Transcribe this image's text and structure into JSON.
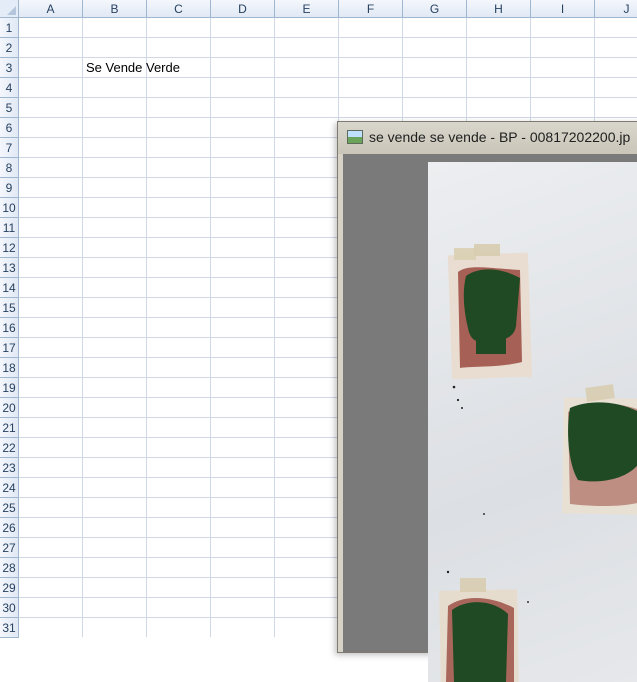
{
  "spreadsheet": {
    "columns": [
      "A",
      "B",
      "C",
      "D",
      "E",
      "F",
      "G",
      "H",
      "I",
      "J"
    ],
    "rows": [
      "1",
      "2",
      "3",
      "4",
      "5",
      "6",
      "7",
      "8",
      "9",
      "10",
      "11",
      "12",
      "13",
      "14",
      "15",
      "16",
      "17",
      "18",
      "19",
      "20",
      "21",
      "22",
      "23",
      "24",
      "25",
      "26",
      "27",
      "28",
      "29",
      "30",
      "31"
    ],
    "cell_B3": "Se Vende Verde"
  },
  "viewer": {
    "title": "se vende se vende - BP - 00817202200.jp",
    "icon": "image-file-icon",
    "content": "photo of green painted papers on white wall"
  },
  "colors": {
    "header_bg": "#e4ecf7",
    "gridline": "#d0d7e5",
    "viewer_frame": "#d6d2c6",
    "viewer_bg": "#7a7a7a",
    "paint_green": "#1f4a24",
    "paper_rust": "#8a3b32"
  }
}
